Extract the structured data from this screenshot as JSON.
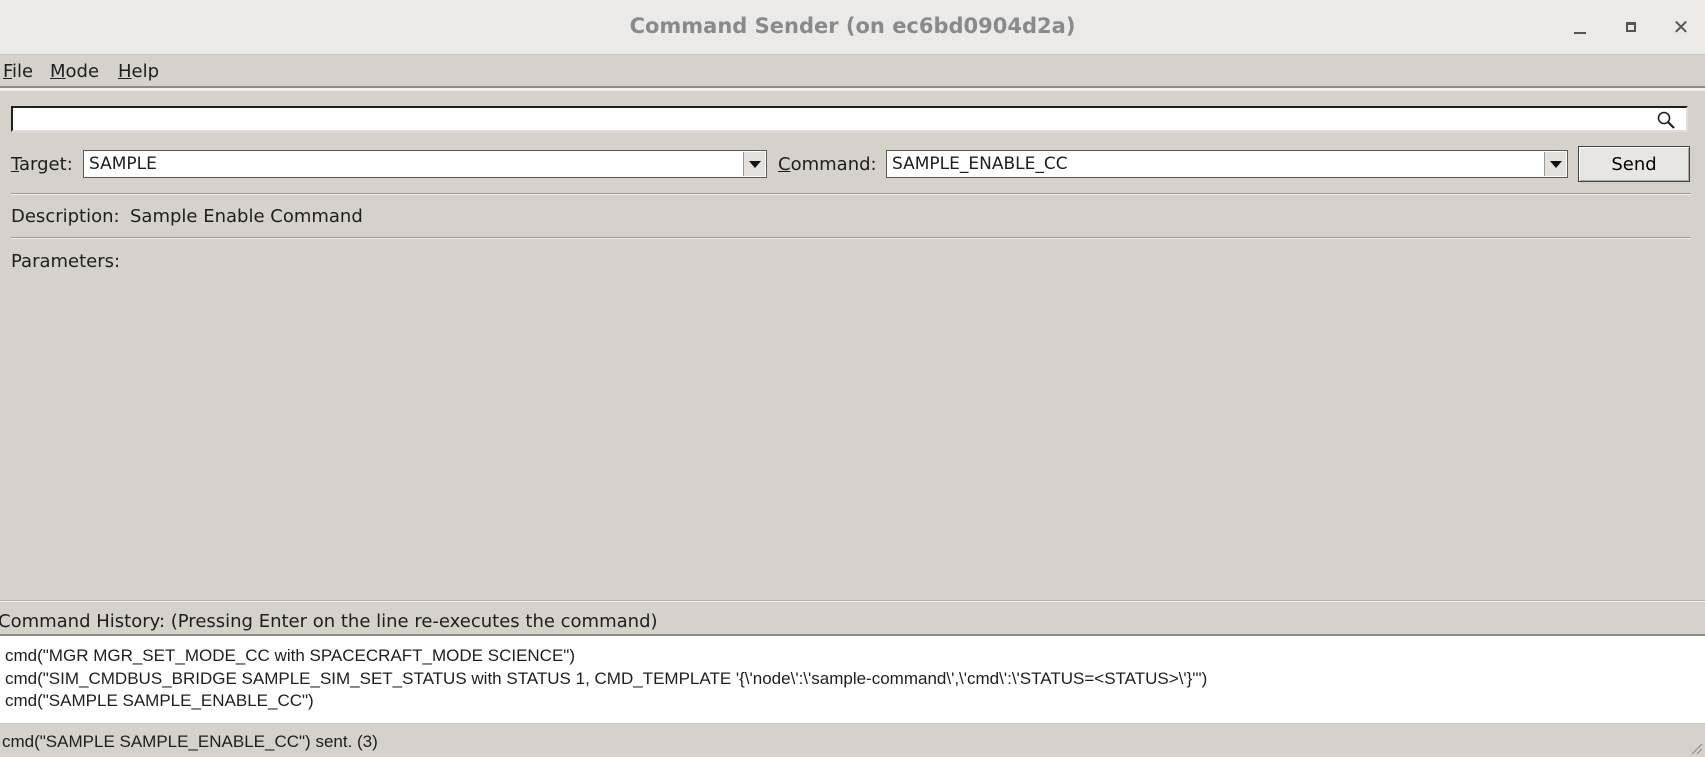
{
  "window": {
    "title": "Command Sender (on ec6bd0904d2a)",
    "controls": {
      "minimize": "minimize",
      "maximize": "maximize",
      "close": "✕"
    }
  },
  "menu": {
    "file": {
      "mnemonic": "F",
      "rest": "ile"
    },
    "mode": {
      "mnemonic": "M",
      "rest": "ode"
    },
    "help": {
      "mnemonic": "H",
      "rest": "elp"
    }
  },
  "search": {
    "value": "",
    "placeholder": ""
  },
  "target": {
    "label_mnemonic": "T",
    "label_rest": "arget:",
    "value": "SAMPLE"
  },
  "command": {
    "label_mnemonic": "C",
    "label_rest": "ommand:",
    "value": "SAMPLE_ENABLE_CC"
  },
  "send_label": "Send",
  "description": {
    "label": "Description:",
    "value": "Sample Enable Command"
  },
  "parameters": {
    "label": "Parameters:"
  },
  "history": {
    "label": "Command History: (Pressing Enter on the line re-executes the command)",
    "lines": [
      "cmd(\"MGR MGR_SET_MODE_CC with SPACECRAFT_MODE SCIENCE\")",
      "cmd(\"SIM_CMDBUS_BRIDGE SAMPLE_SIM_SET_STATUS with STATUS 1, CMD_TEMPLATE '{\\'node\\':\\'sample-command\\',\\'cmd\\':\\'STATUS=<STATUS>\\'}'\")",
      "cmd(\"SAMPLE SAMPLE_ENABLE_CC\")"
    ]
  },
  "status": "cmd(\"SAMPLE SAMPLE_ENABLE_CC\") sent. (3)",
  "icons": {
    "search": "search-icon",
    "dropdown": "chevron-down-icon",
    "resize": "resize-grip-icon"
  }
}
